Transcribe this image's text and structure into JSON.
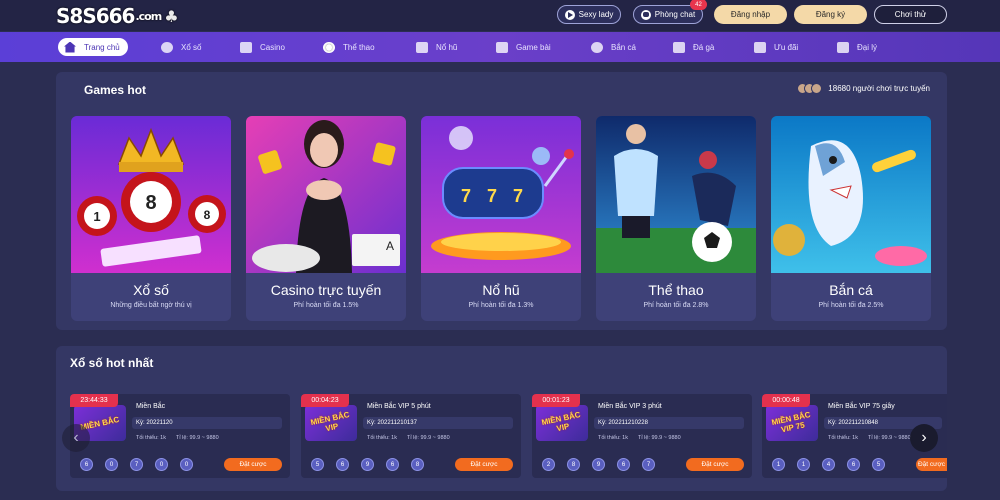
{
  "header": {
    "logo_text": "S8S666",
    "logo_suffix": ".com",
    "sexy_lady": "Sexy lady",
    "chat_room": "Phòng chat",
    "chat_badge": "42",
    "login": "Đăng nhập",
    "register": "Đăng ký",
    "demo": "Chơi thử"
  },
  "nav": {
    "items": [
      {
        "label": "Trang chủ",
        "icon": "home-icon"
      },
      {
        "label": "Xổ số",
        "icon": "lottery-icon"
      },
      {
        "label": "Casino",
        "icon": "play-icon"
      },
      {
        "label": "Thể thao",
        "icon": "ball-icon"
      },
      {
        "label": "Nổ hũ",
        "icon": "slot-icon"
      },
      {
        "label": "Game bài",
        "icon": "cards-icon"
      },
      {
        "label": "Bắn cá",
        "icon": "fish-icon"
      },
      {
        "label": "Đá gà",
        "icon": "rooster-icon"
      },
      {
        "label": "Ưu đãi",
        "icon": "gift-icon"
      },
      {
        "label": "Đại lý",
        "icon": "agent-icon"
      }
    ]
  },
  "games": {
    "title": "Games hot",
    "online": "18680 người chơi trực tuyến",
    "cards": [
      {
        "name": "Xổ số",
        "sub": "Những điều bất ngờ thú vị"
      },
      {
        "name": "Casino trực tuyến",
        "sub": "Phí hoàn tối đa 1.5%"
      },
      {
        "name": "Nổ hũ",
        "sub": "Phí hoàn tối đa 1.3%"
      },
      {
        "name": "Thể thao",
        "sub": "Phí hoàn tối đa 2.8%"
      },
      {
        "name": "Bắn cá",
        "sub": "Phí hoàn tối đa 2.5%"
      }
    ]
  },
  "lottery": {
    "title": "Xổ số hot nhất",
    "items": [
      {
        "timer": "23:44:33",
        "thumb": "MIỀN BẮC",
        "name": "Miền Bắc",
        "id": "Kỳ: 20221120",
        "min": "Tối thiểu: 1k",
        "rate": "Tỉ lệ: 99.9 ~ 9880",
        "balls": [
          "6",
          "0",
          "7",
          "0",
          "0"
        ],
        "bet": "Đặt cược"
      },
      {
        "timer": "00:04:23",
        "thumb": "MIỀN BẮC VIP",
        "name": "Miền Bắc VIP 5 phút",
        "id": "Kỳ: 202211210137",
        "min": "Tối thiểu: 1k",
        "rate": "Tỉ lệ: 99.9 ~ 9880",
        "balls": [
          "5",
          "6",
          "9",
          "6",
          "8"
        ],
        "bet": "Đặt cược"
      },
      {
        "timer": "00:01:23",
        "thumb": "MIỀN BẮC VIP",
        "name": "Miền Bắc VIP 3 phút",
        "id": "Kỳ: 202211210228",
        "min": "Tối thiểu: 1k",
        "rate": "Tỉ lệ: 99.9 ~ 9880",
        "balls": [
          "2",
          "8",
          "9",
          "6",
          "7"
        ],
        "bet": "Đặt cược"
      },
      {
        "timer": "00:00:48",
        "thumb": "MIỀN BẮC VIP 75",
        "name": "Miền Bắc VIP 75 giây",
        "id": "Kỳ: 202211210848",
        "min": "Tối thiểu: 1k",
        "rate": "Tỉ lệ: 99.9 ~ 9880",
        "balls": [
          "1",
          "1",
          "4",
          "6",
          "5"
        ],
        "bet": "Đặt cược"
      }
    ]
  }
}
